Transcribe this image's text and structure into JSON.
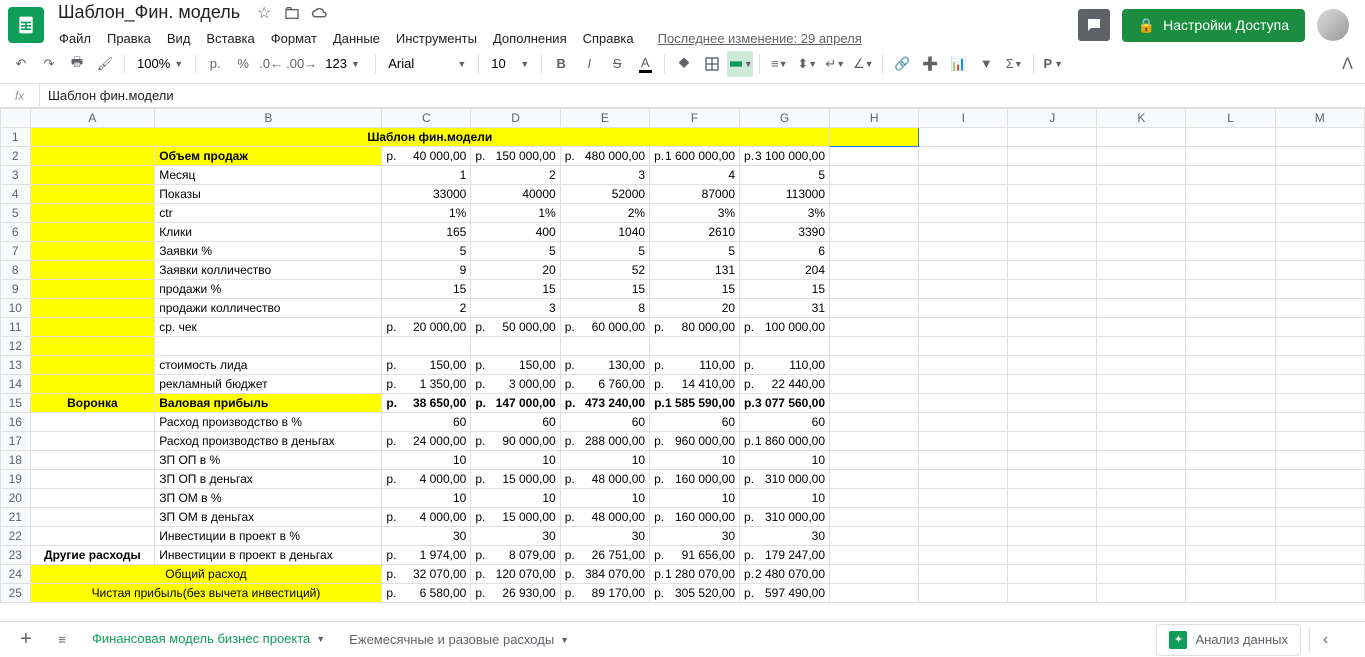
{
  "doc": {
    "title": "Шаблон_Фин. модель"
  },
  "menu": {
    "file": "Файл",
    "edit": "Правка",
    "view": "Вид",
    "insert": "Вставка",
    "format": "Формат",
    "data": "Данные",
    "tools": "Инструменты",
    "addons": "Дополнения",
    "help": "Справка",
    "lastEdit": "Последнее изменение: 29 апреля"
  },
  "share": {
    "label": "Настройки Доступа"
  },
  "toolbar": {
    "zoom": "100%",
    "currency": "р.",
    "percent": "%",
    "font": "Arial",
    "size": "10",
    "123": "123"
  },
  "formula": {
    "fx": "fx",
    "value": "Шаблон фин.модели"
  },
  "cols": [
    "A",
    "B",
    "C",
    "D",
    "E",
    "F",
    "G",
    "H",
    "I",
    "J",
    "K",
    "L",
    "M"
  ],
  "rows": [
    {
      "n": 1,
      "style": "yellow bold center",
      "merge": "A:G",
      "val": "Шаблон фин.модели",
      "hYellow": true
    },
    {
      "n": 2,
      "aStyle": "yellow",
      "b": "Объем продаж",
      "bStyle": "yellow bold",
      "c": [
        "р.",
        "40 000,00"
      ],
      "d": [
        "р.",
        "150 000,00"
      ],
      "e": [
        "р.",
        "480 000,00"
      ],
      "f": [
        "р.",
        "1 600 000,00"
      ],
      "g": [
        "р.",
        "3 100 000,00"
      ],
      "cur": true
    },
    {
      "n": 3,
      "aStyle": "yellow",
      "b": "Месяц",
      "c": "1",
      "d": "2",
      "e": "3",
      "f": "4",
      "g": "5"
    },
    {
      "n": 4,
      "aStyle": "yellow",
      "b": "Показы",
      "c": "33000",
      "d": "40000",
      "e": "52000",
      "f": "87000",
      "g": "113000"
    },
    {
      "n": 5,
      "aStyle": "yellow",
      "b": "ctr",
      "c": "1%",
      "d": "1%",
      "e": "2%",
      "f": "3%",
      "g": "3%"
    },
    {
      "n": 6,
      "aStyle": "yellow",
      "b": "Клики",
      "c": "165",
      "d": "400",
      "e": "1040",
      "f": "2610",
      "g": "3390"
    },
    {
      "n": 7,
      "aStyle": "yellow",
      "b": "Заявки %",
      "c": "5",
      "d": "5",
      "e": "5",
      "f": "5",
      "g": "6"
    },
    {
      "n": 8,
      "aStyle": "yellow",
      "b": "Заявки колличество",
      "c": "9",
      "d": "20",
      "e": "52",
      "f": "131",
      "g": "204"
    },
    {
      "n": 9,
      "aStyle": "yellow",
      "b": "продажи %",
      "c": "15",
      "d": "15",
      "e": "15",
      "f": "15",
      "g": "15"
    },
    {
      "n": 10,
      "aStyle": "yellow",
      "b": "продажи колличество",
      "c": "2",
      "d": "3",
      "e": "8",
      "f": "20",
      "g": "31"
    },
    {
      "n": 11,
      "aStyle": "yellow",
      "b": "ср. чек",
      "c": [
        "р.",
        "20 000,00"
      ],
      "d": [
        "р.",
        "50 000,00"
      ],
      "e": [
        "р.",
        "60 000,00"
      ],
      "f": [
        "р.",
        "80 000,00"
      ],
      "g": [
        "р.",
        "100 000,00"
      ],
      "cur": true
    },
    {
      "n": 12,
      "aStyle": "yellow",
      "b": ""
    },
    {
      "n": 13,
      "aStyle": "yellow",
      "b": "стоимость лида",
      "c": [
        "р.",
        "150,00"
      ],
      "d": [
        "р.",
        "150,00"
      ],
      "e": [
        "р.",
        "130,00"
      ],
      "f": [
        "р.",
        "110,00"
      ],
      "g": [
        "р.",
        "110,00"
      ],
      "cur": true
    },
    {
      "n": 14,
      "aStyle": "yellow",
      "b": "рекламный бюджет",
      "c": [
        "р.",
        "1 350,00"
      ],
      "d": [
        "р.",
        "3 000,00"
      ],
      "e": [
        "р.",
        "6 760,00"
      ],
      "f": [
        "р.",
        "14 410,00"
      ],
      "g": [
        "р.",
        "22 440,00"
      ],
      "cur": true
    },
    {
      "n": 15,
      "a": "Воронка",
      "aStyle": "yellow bold center",
      "b": "Валовая прибыль",
      "bStyle": "yellow bold",
      "rowBold": true,
      "c": [
        "р.",
        "38 650,00"
      ],
      "d": [
        "р.",
        "147 000,00"
      ],
      "e": [
        "р.",
        "473 240,00"
      ],
      "f": [
        "р.",
        "1 585 590,00"
      ],
      "g": [
        "р.",
        "3 077 560,00"
      ],
      "cur": true
    },
    {
      "n": 16,
      "b": "Расход производство в %",
      "c": "60",
      "d": "60",
      "e": "60",
      "f": "60",
      "g": "60"
    },
    {
      "n": 17,
      "b": "Расход производство в деньгах",
      "c": [
        "р.",
        "24 000,00"
      ],
      "d": [
        "р.",
        "90 000,00"
      ],
      "e": [
        "р.",
        "288 000,00"
      ],
      "f": [
        "р.",
        "960 000,00"
      ],
      "g": [
        "р.",
        "1 860 000,00"
      ],
      "cur": true
    },
    {
      "n": 18,
      "b": "ЗП ОП в %",
      "c": "10",
      "d": "10",
      "e": "10",
      "f": "10",
      "g": "10"
    },
    {
      "n": 19,
      "b": "ЗП ОП в деньгах",
      "c": [
        "р.",
        "4 000,00"
      ],
      "d": [
        "р.",
        "15 000,00"
      ],
      "e": [
        "р.",
        "48 000,00"
      ],
      "f": [
        "р.",
        "160 000,00"
      ],
      "g": [
        "р.",
        "310 000,00"
      ],
      "cur": true
    },
    {
      "n": 20,
      "b": "ЗП ОМ в %",
      "c": "10",
      "d": "10",
      "e": "10",
      "f": "10",
      "g": "10"
    },
    {
      "n": 21,
      "b": "ЗП ОМ в деньгах",
      "c": [
        "р.",
        "4 000,00"
      ],
      "d": [
        "р.",
        "15 000,00"
      ],
      "e": [
        "р.",
        "48 000,00"
      ],
      "f": [
        "р.",
        "160 000,00"
      ],
      "g": [
        "р.",
        "310 000,00"
      ],
      "cur": true
    },
    {
      "n": 22,
      "b": "Инвестиции в проект в %",
      "c": "30",
      "d": "30",
      "e": "30",
      "f": "30",
      "g": "30"
    },
    {
      "n": 23,
      "a": "Другие расходы",
      "aStyle": "bold center",
      "b": "Инвестиции в проект в деньгах",
      "c": [
        "р.",
        "1 974,00"
      ],
      "d": [
        "р.",
        "8 079,00"
      ],
      "e": [
        "р.",
        "26 751,00"
      ],
      "f": [
        "р.",
        "91 656,00"
      ],
      "g": [
        "р.",
        "179 247,00"
      ],
      "cur": true
    },
    {
      "n": 24,
      "merge": "A:B",
      "val": "Общий расход",
      "style": "yellow center",
      "c": [
        "р.",
        "32 070,00"
      ],
      "d": [
        "р.",
        "120 070,00"
      ],
      "e": [
        "р.",
        "384 070,00"
      ],
      "f": [
        "р.",
        "1 280 070,00"
      ],
      "g": [
        "р.",
        "2 480 070,00"
      ],
      "cur": true
    },
    {
      "n": 25,
      "merge": "A:B",
      "val": "Чистая прибыль(без вычета инвестиций)",
      "style": "yellow center",
      "c": [
        "р.",
        "6 580,00"
      ],
      "d": [
        "р.",
        "26 930,00"
      ],
      "e": [
        "р.",
        "89 170,00"
      ],
      "f": [
        "р.",
        "305 520,00"
      ],
      "g": [
        "р.",
        "597 490,00"
      ],
      "cur": true
    }
  ],
  "tabs": {
    "active": "Финансовая модель бизнес проекта",
    "inactive": "Ежемесячные и разовые расходы"
  },
  "explore": {
    "label": "Анализ данных"
  }
}
